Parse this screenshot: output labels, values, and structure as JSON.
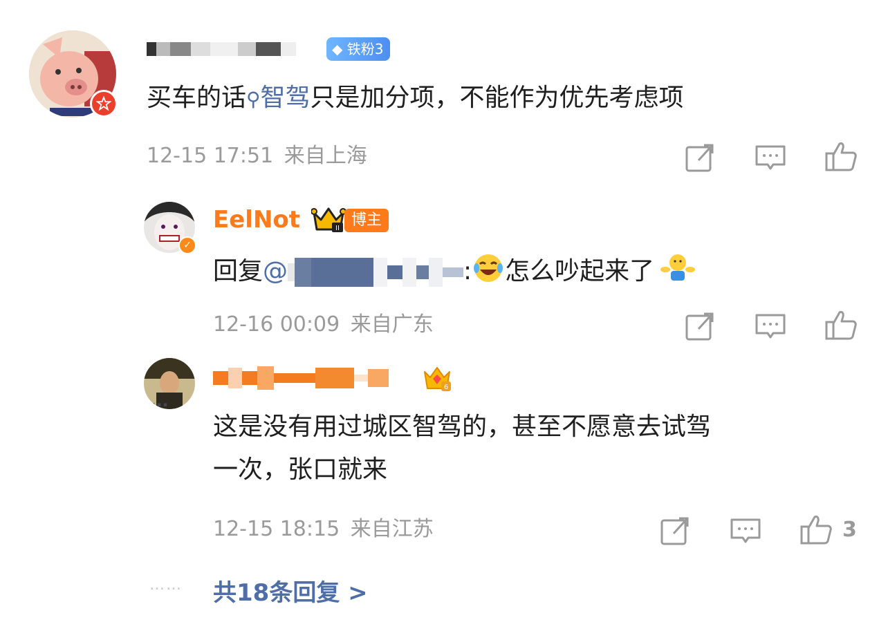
{
  "comments": [
    {
      "badge": "铁粉3",
      "text_before": "买车的话",
      "topic": "智驾",
      "text_after": "只是加分项，不能作为优先考虑项",
      "time": "12-15 17:51",
      "location": "来自上海"
    },
    {
      "username": "EelNot",
      "badge": "博主",
      "reply_prefix": "回复",
      "mention_symbol": "@",
      "colon": ":",
      "text": "怎么吵起来了",
      "time": "12-16 00:09",
      "location": "来自广东"
    },
    {
      "text_line1": "这是没有用过城区智驾的，甚至不愿意去试驾",
      "text_line2": "一次，张口就来",
      "time": "12-15 18:15",
      "location": "来自江苏",
      "like_count": "3"
    }
  ],
  "more_dots": "……",
  "more_replies_label": "共18条回复 >",
  "colors": {
    "meta_gray": "#9a9a9a",
    "link_blue": "#4f6ea8",
    "host_orange": "#ff7a1a",
    "fan_blue": "#4d8ef0"
  },
  "icons": [
    "share-icon",
    "comment-icon",
    "like-icon",
    "crown-icon",
    "verified-icon",
    "emoji-laugh-cry",
    "emoji-shrug"
  ]
}
